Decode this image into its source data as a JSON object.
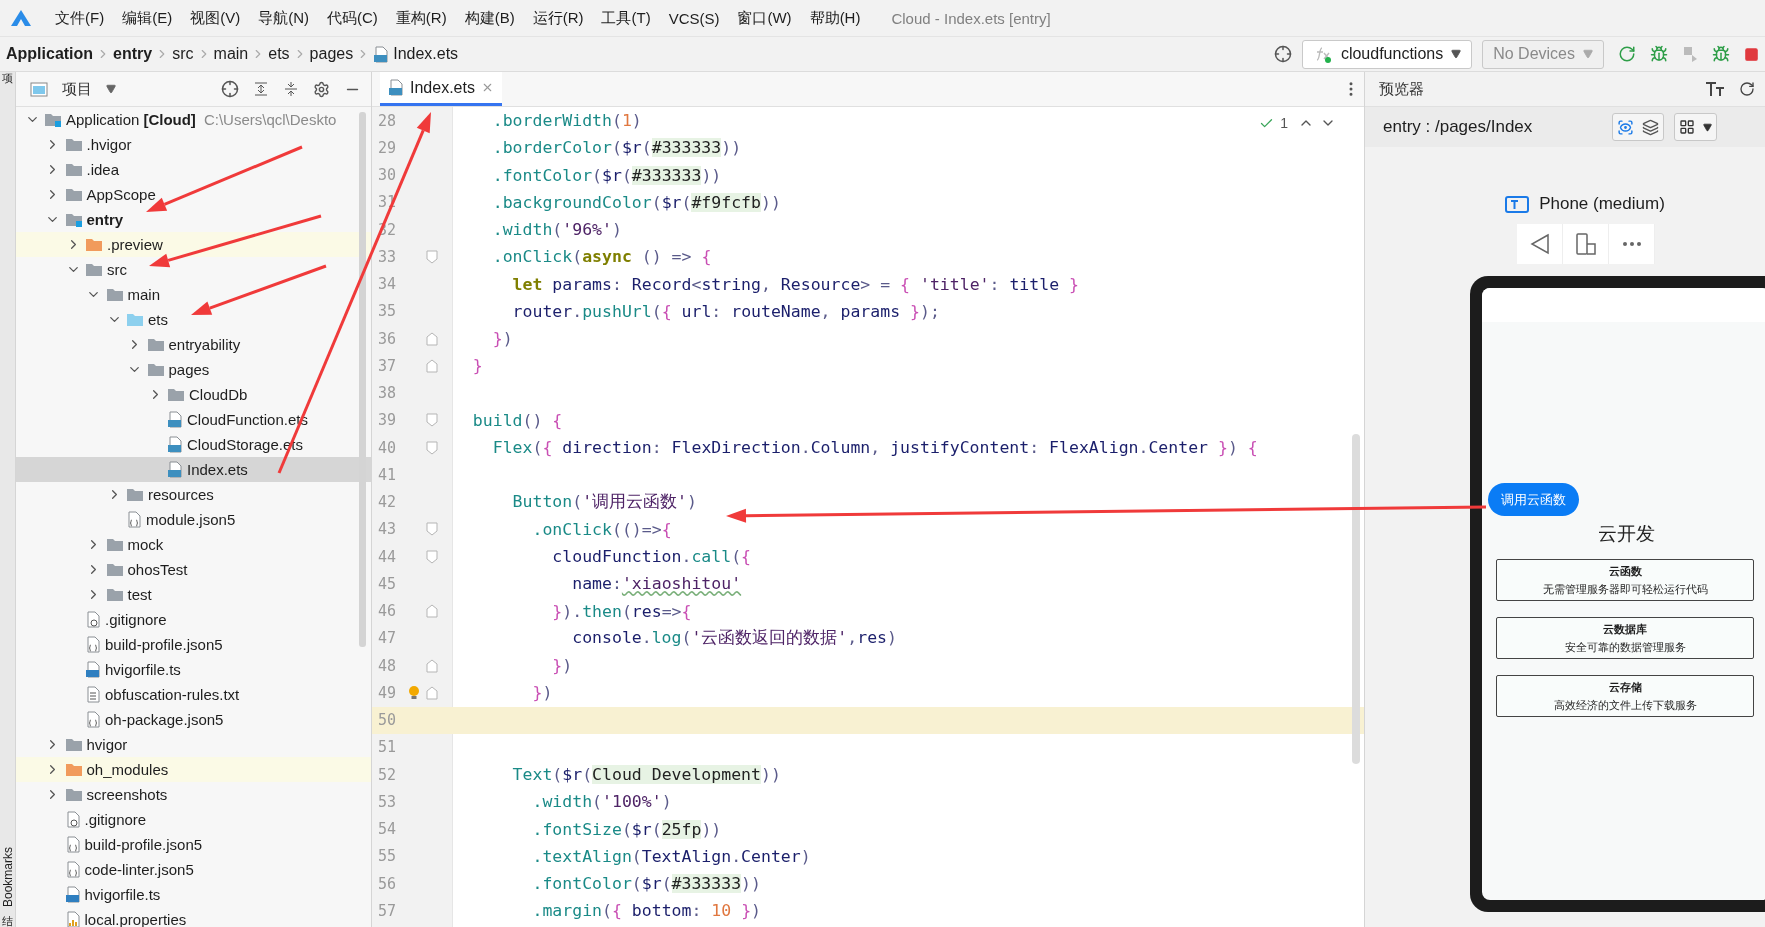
{
  "menu_bar": {
    "items": [
      "文件(F)",
      "编辑(E)",
      "视图(V)",
      "导航(N)",
      "代码(C)",
      "重构(R)",
      "构建(B)",
      "运行(R)",
      "工具(T)",
      "VCS(S)",
      "窗口(W)",
      "帮助(H)"
    ],
    "title": "Cloud - Index.ets [entry]"
  },
  "breadcrumbs": [
    {
      "label": "Application",
      "bold": true
    },
    {
      "label": "entry",
      "bold": true
    },
    {
      "label": "src",
      "bold": false
    },
    {
      "label": "main",
      "bold": false
    },
    {
      "label": "ets",
      "bold": false
    },
    {
      "label": "pages",
      "bold": false
    },
    {
      "label": "Index.ets",
      "bold": false
    }
  ],
  "run_toolbar": {
    "config": "cloudfunctions",
    "device": "No Devices",
    "device_disabled": true
  },
  "side_strip": [
    "项",
    "Bookmarks",
    "结"
  ],
  "project_panel": {
    "title": "项目",
    "tree": [
      {
        "label": "Application",
        "tag": "[Cloud]",
        "path": "C:\\Users\\qcl\\Deskto",
        "kind": "module",
        "bold": false,
        "expanded": true,
        "selected": false,
        "children": [
          {
            "label": ".hvigor",
            "kind": "folder",
            "bold": false,
            "expanded": false,
            "selected": false
          },
          {
            "label": ".idea",
            "kind": "folder",
            "bold": false,
            "expanded": false,
            "selected": false
          },
          {
            "label": "AppScope",
            "kind": "folder",
            "bold": false,
            "expanded": false,
            "selected": false
          },
          {
            "label": "entry",
            "kind": "module",
            "bold": true,
            "expanded": true,
            "selected": false,
            "children": [
              {
                "label": ".preview",
                "kind": "excluded",
                "bold": false,
                "expanded": false,
                "selected": false
              },
              {
                "label": "src",
                "kind": "folder",
                "bold": false,
                "expanded": true,
                "selected": false,
                "children": [
                  {
                    "label": "main",
                    "kind": "folder",
                    "bold": false,
                    "expanded": true,
                    "selected": false,
                    "children": [
                      {
                        "label": "ets",
                        "kind": "source",
                        "bold": false,
                        "expanded": true,
                        "selected": false,
                        "children": [
                          {
                            "label": "entryability",
                            "kind": "folder",
                            "bold": false,
                            "expanded": false,
                            "selected": false
                          },
                          {
                            "label": "pages",
                            "kind": "folder",
                            "bold": false,
                            "expanded": true,
                            "selected": false,
                            "children": [
                              {
                                "label": "CloudDb",
                                "kind": "folder",
                                "bold": false,
                                "expanded": false,
                                "selected": false
                              },
                              {
                                "label": "CloudFunction.ets",
                                "kind": "ets",
                                "bold": false,
                                "selected": false
                              },
                              {
                                "label": "CloudStorage.ets",
                                "kind": "ets",
                                "bold": false,
                                "selected": false
                              },
                              {
                                "label": "Index.ets",
                                "kind": "ets",
                                "bold": false,
                                "selected": true
                              }
                            ]
                          }
                        ]
                      },
                      {
                        "label": "resources",
                        "kind": "folder",
                        "bold": false,
                        "expanded": false,
                        "selected": false
                      },
                      {
                        "label": "module.json5",
                        "kind": "json",
                        "bold": false,
                        "selected": false
                      }
                    ]
                  },
                  {
                    "label": "mock",
                    "kind": "folder",
                    "bold": false,
                    "expanded": false,
                    "selected": false
                  },
                  {
                    "label": "ohosTest",
                    "kind": "folder",
                    "bold": false,
                    "expanded": false,
                    "selected": false
                  },
                  {
                    "label": "test",
                    "kind": "folder",
                    "bold": false,
                    "expanded": false,
                    "selected": false
                  }
                ]
              },
              {
                "label": ".gitignore",
                "kind": "ignore",
                "bold": false,
                "selected": false
              },
              {
                "label": "build-profile.json5",
                "kind": "json",
                "bold": false,
                "selected": false
              },
              {
                "label": "hvigorfile.ts",
                "kind": "ts",
                "bold": false,
                "selected": false
              },
              {
                "label": "obfuscation-rules.txt",
                "kind": "text",
                "bold": false,
                "selected": false
              },
              {
                "label": "oh-package.json5",
                "kind": "json",
                "bold": false,
                "selected": false
              }
            ]
          },
          {
            "label": "hvigor",
            "kind": "folder",
            "bold": false,
            "expanded": false,
            "selected": false
          },
          {
            "label": "oh_modules",
            "kind": "excluded",
            "bold": false,
            "expanded": false,
            "selected": false
          },
          {
            "label": "screenshots",
            "kind": "folder",
            "bold": false,
            "expanded": false,
            "selected": false
          },
          {
            "label": ".gitignore",
            "kind": "ignore",
            "bold": false,
            "selected": false
          },
          {
            "label": "build-profile.json5",
            "kind": "json",
            "bold": false,
            "selected": false
          },
          {
            "label": "code-linter.json5",
            "kind": "json",
            "bold": false,
            "selected": false
          },
          {
            "label": "hvigorfile.ts",
            "kind": "ts",
            "bold": false,
            "selected": false
          },
          {
            "label": "local.properties",
            "kind": "properties",
            "bold": false,
            "selected": false
          }
        ]
      }
    ]
  },
  "editor": {
    "tabs": [
      {
        "label": "Index.ets",
        "selected": true
      }
    ],
    "problems": "1",
    "lines": [
      {
        "number": "28",
        "kind": "plain",
        "current": false,
        "tokens": [
          {
            "text": "    .borderWidth",
            "kind": "method"
          },
          {
            "text": "(",
            "kind": "punct"
          },
          {
            "text": "1",
            "kind": "number"
          },
          {
            "text": ")",
            "kind": "punct"
          }
        ]
      },
      {
        "number": "29",
        "kind": "plain",
        "current": false,
        "tokens": [
          {
            "text": "    .borderColor",
            "kind": "method"
          },
          {
            "text": "(",
            "kind": "punct"
          },
          {
            "text": "$r",
            "kind": "ident"
          },
          {
            "text": "(",
            "kind": "punct"
          },
          {
            "text": "#333333",
            "kind": "resource"
          },
          {
            "text": "))",
            "kind": "punct"
          }
        ]
      },
      {
        "number": "30",
        "kind": "plain",
        "current": false,
        "tokens": [
          {
            "text": "    .fontColor",
            "kind": "method"
          },
          {
            "text": "(",
            "kind": "punct"
          },
          {
            "text": "$r",
            "kind": "ident"
          },
          {
            "text": "(",
            "kind": "punct"
          },
          {
            "text": "#333333",
            "kind": "resource"
          },
          {
            "text": "))",
            "kind": "punct"
          }
        ]
      },
      {
        "number": "31",
        "kind": "plain",
        "current": false,
        "tokens": [
          {
            "text": "    .backgroundColor",
            "kind": "method"
          },
          {
            "text": "(",
            "kind": "punct"
          },
          {
            "text": "$r",
            "kind": "ident"
          },
          {
            "text": "(",
            "kind": "punct"
          },
          {
            "text": "#f9fcfb",
            "kind": "resource"
          },
          {
            "text": "))",
            "kind": "punct"
          }
        ]
      },
      {
        "number": "32",
        "kind": "plain",
        "current": false,
        "tokens": [
          {
            "text": "    .width",
            "kind": "method"
          },
          {
            "text": "(",
            "kind": "punct"
          },
          {
            "text": "'96%'",
            "kind": "string"
          },
          {
            "text": ")",
            "kind": "punct"
          }
        ]
      },
      {
        "number": "33",
        "kind": "fold-start",
        "current": false,
        "tokens": [
          {
            "text": "    .onClick",
            "kind": "method"
          },
          {
            "text": "(",
            "kind": "punct"
          },
          {
            "text": "async",
            "kind": "keyword"
          },
          {
            "text": " () => ",
            "kind": "punct"
          },
          {
            "text": "{",
            "kind": "brace"
          }
        ]
      },
      {
        "number": "34",
        "kind": "plain",
        "current": false,
        "tokens": [
          {
            "text": "      let",
            "kind": "keyword"
          },
          {
            "text": " params",
            "kind": "ident"
          },
          {
            "text": ": ",
            "kind": "punct"
          },
          {
            "text": "Record",
            "kind": "ident"
          },
          {
            "text": "<",
            "kind": "punct"
          },
          {
            "text": "string",
            "kind": "ident"
          },
          {
            "text": ", ",
            "kind": "punct"
          },
          {
            "text": "Resource",
            "kind": "ident"
          },
          {
            "text": "> = ",
            "kind": "punct"
          },
          {
            "text": "{ ",
            "kind": "brace"
          },
          {
            "text": "'title'",
            "kind": "string"
          },
          {
            "text": ": ",
            "kind": "punct"
          },
          {
            "text": "title ",
            "kind": "ident"
          },
          {
            "text": "}",
            "kind": "brace"
          }
        ]
      },
      {
        "number": "35",
        "kind": "plain",
        "current": false,
        "tokens": [
          {
            "text": "      router",
            "kind": "ident"
          },
          {
            "text": ".",
            "kind": "punct"
          },
          {
            "text": "pushUrl",
            "kind": "method"
          },
          {
            "text": "(",
            "kind": "punct"
          },
          {
            "text": "{ ",
            "kind": "brace"
          },
          {
            "text": "url",
            "kind": "ident"
          },
          {
            "text": ": ",
            "kind": "punct"
          },
          {
            "text": "routeName",
            "kind": "ident"
          },
          {
            "text": ", ",
            "kind": "punct"
          },
          {
            "text": "params ",
            "kind": "ident"
          },
          {
            "text": "}",
            "kind": "brace"
          },
          {
            "text": ");",
            "kind": "punct"
          }
        ]
      },
      {
        "number": "36",
        "kind": "fold-end",
        "current": false,
        "tokens": [
          {
            "text": "    }",
            "kind": "brace"
          },
          {
            "text": ")",
            "kind": "punct"
          }
        ]
      },
      {
        "number": "37",
        "kind": "fold-end",
        "current": false,
        "tokens": [
          {
            "text": "  }",
            "kind": "brace"
          }
        ]
      },
      {
        "number": "38",
        "kind": "plain",
        "current": false
      },
      {
        "number": "39",
        "kind": "fold-start",
        "current": false,
        "tokens": [
          {
            "text": "  build",
            "kind": "func"
          },
          {
            "text": "() ",
            "kind": "punct"
          },
          {
            "text": "{",
            "kind": "brace"
          }
        ]
      },
      {
        "number": "40",
        "kind": "fold-start",
        "current": false,
        "tokens": [
          {
            "text": "    Flex",
            "kind": "func"
          },
          {
            "text": "(",
            "kind": "punct"
          },
          {
            "text": "{ ",
            "kind": "brace"
          },
          {
            "text": "direction",
            "kind": "ident"
          },
          {
            "text": ": ",
            "kind": "punct"
          },
          {
            "text": "FlexDirection",
            "kind": "ident"
          },
          {
            "text": ".",
            "kind": "punct"
          },
          {
            "text": "Column",
            "kind": "ident"
          },
          {
            "text": ", ",
            "kind": "punct"
          },
          {
            "text": "justifyContent",
            "kind": "ident"
          },
          {
            "text": ": ",
            "kind": "punct"
          },
          {
            "text": "FlexAlign",
            "kind": "ident"
          },
          {
            "text": ".",
            "kind": "punct"
          },
          {
            "text": "Center ",
            "kind": "ident"
          },
          {
            "text": "}",
            "kind": "brace"
          },
          {
            "text": ") ",
            "kind": "punct"
          },
          {
            "text": "{",
            "kind": "brace"
          }
        ]
      },
      {
        "number": "41",
        "kind": "plain",
        "current": false
      },
      {
        "number": "42",
        "kind": "plain",
        "current": false,
        "tokens": [
          {
            "text": "      Button",
            "kind": "func"
          },
          {
            "text": "(",
            "kind": "punct"
          },
          {
            "text": "'调用云函数'",
            "kind": "string"
          },
          {
            "text": ")",
            "kind": "punct"
          }
        ]
      },
      {
        "number": "43",
        "kind": "fold-start",
        "current": false,
        "tokens": [
          {
            "text": "        .onClick",
            "kind": "method"
          },
          {
            "text": "(()=>",
            "kind": "punct"
          },
          {
            "text": "{",
            "kind": "brace"
          }
        ]
      },
      {
        "number": "44",
        "kind": "fold-start",
        "current": false,
        "tokens": [
          {
            "text": "          cloudFunction",
            "kind": "ident"
          },
          {
            "text": ".",
            "kind": "punct"
          },
          {
            "text": "call",
            "kind": "method"
          },
          {
            "text": "(",
            "kind": "punct"
          },
          {
            "text": "{",
            "kind": "brace"
          }
        ]
      },
      {
        "number": "45",
        "kind": "plain",
        "current": false,
        "tokens": [
          {
            "text": "            name",
            "kind": "ident"
          },
          {
            "text": ":",
            "kind": "punct"
          },
          {
            "text": "'xiaoshitou'",
            "kind": "typo"
          }
        ]
      },
      {
        "number": "46",
        "kind": "fold-end",
        "current": false,
        "tokens": [
          {
            "text": "          }",
            "kind": "brace"
          },
          {
            "text": ").",
            "kind": "punct"
          },
          {
            "text": "then",
            "kind": "method"
          },
          {
            "text": "(",
            "kind": "punct"
          },
          {
            "text": "res",
            "kind": "ident"
          },
          {
            "text": "=>",
            "kind": "punct"
          },
          {
            "text": "{",
            "kind": "brace"
          }
        ]
      },
      {
        "number": "47",
        "kind": "plain",
        "current": false,
        "tokens": [
          {
            "text": "            console",
            "kind": "ident"
          },
          {
            "text": ".",
            "kind": "punct"
          },
          {
            "text": "log",
            "kind": "method"
          },
          {
            "text": "(",
            "kind": "punct"
          },
          {
            "text": "'云函数返回的数据'",
            "kind": "string"
          },
          {
            "text": ",",
            "kind": "punct"
          },
          {
            "text": "res",
            "kind": "ident"
          },
          {
            "text": ")",
            "kind": "punct"
          }
        ]
      },
      {
        "number": "48",
        "kind": "fold-end",
        "current": false,
        "tokens": [
          {
            "text": "          }",
            "kind": "brace"
          },
          {
            "text": ")",
            "kind": "punct"
          }
        ]
      },
      {
        "number": "49",
        "kind": "fold-end",
        "current": false,
        "hint": true,
        "tokens": [
          {
            "text": "        }",
            "kind": "brace"
          },
          {
            "text": ")",
            "kind": "punct"
          }
        ]
      },
      {
        "number": "50",
        "kind": "plain",
        "current": true
      },
      {
        "number": "51",
        "kind": "plain",
        "current": false
      },
      {
        "number": "52",
        "kind": "plain",
        "current": false,
        "tokens": [
          {
            "text": "      Text",
            "kind": "func"
          },
          {
            "text": "(",
            "kind": "punct"
          },
          {
            "text": "$r",
            "kind": "ident"
          },
          {
            "text": "(",
            "kind": "punct"
          },
          {
            "text": "Cloud Development",
            "kind": "resource"
          },
          {
            "text": "))",
            "kind": "punct"
          }
        ]
      },
      {
        "number": "53",
        "kind": "plain",
        "current": false,
        "tokens": [
          {
            "text": "        .width",
            "kind": "method"
          },
          {
            "text": "(",
            "kind": "punct"
          },
          {
            "text": "'100%'",
            "kind": "string"
          },
          {
            "text": ")",
            "kind": "punct"
          }
        ]
      },
      {
        "number": "54",
        "kind": "plain",
        "current": false,
        "tokens": [
          {
            "text": "        .fontSize",
            "kind": "method"
          },
          {
            "text": "(",
            "kind": "punct"
          },
          {
            "text": "$r",
            "kind": "ident"
          },
          {
            "text": "(",
            "kind": "punct"
          },
          {
            "text": "25fp",
            "kind": "resource"
          },
          {
            "text": "))",
            "kind": "punct"
          }
        ]
      },
      {
        "number": "55",
        "kind": "plain",
        "current": false,
        "tokens": [
          {
            "text": "        .textAlign",
            "kind": "method"
          },
          {
            "text": "(",
            "kind": "punct"
          },
          {
            "text": "TextAlign",
            "kind": "ident"
          },
          {
            "text": ".",
            "kind": "punct"
          },
          {
            "text": "Center",
            "kind": "ident"
          },
          {
            "text": ")",
            "kind": "punct"
          }
        ]
      },
      {
        "number": "56",
        "kind": "plain",
        "current": false,
        "tokens": [
          {
            "text": "        .fontColor",
            "kind": "method"
          },
          {
            "text": "(",
            "kind": "punct"
          },
          {
            "text": "$r",
            "kind": "ident"
          },
          {
            "text": "(",
            "kind": "punct"
          },
          {
            "text": "#333333",
            "kind": "resource"
          },
          {
            "text": "))",
            "kind": "punct"
          }
        ]
      },
      {
        "number": "57",
        "kind": "plain",
        "current": false,
        "tokens": [
          {
            "text": "        .margin",
            "kind": "method"
          },
          {
            "text": "(",
            "kind": "punct"
          },
          {
            "text": "{ ",
            "kind": "brace"
          },
          {
            "text": "bottom",
            "kind": "ident"
          },
          {
            "text": ": ",
            "kind": "punct"
          },
          {
            "text": "10 ",
            "kind": "number"
          },
          {
            "text": "}",
            "kind": "brace"
          },
          {
            "text": ")",
            "kind": "punct"
          }
        ]
      }
    ]
  },
  "previewer": {
    "title": "预览器",
    "route": "entry : /pages/Index",
    "device": "Phone (medium)",
    "phone": {
      "button": "调用云函数",
      "heading": "云开发",
      "cards": [
        {
          "title": "云函数",
          "subtitle": "无需管理服务器即可轻松运行代码"
        },
        {
          "title": "云数据库",
          "subtitle": "安全可靠的数据管理服务"
        },
        {
          "title": "云存储",
          "subtitle": "高效经济的文件上传下载服务"
        }
      ]
    }
  },
  "annotation": {
    "kind": "arrows"
  }
}
